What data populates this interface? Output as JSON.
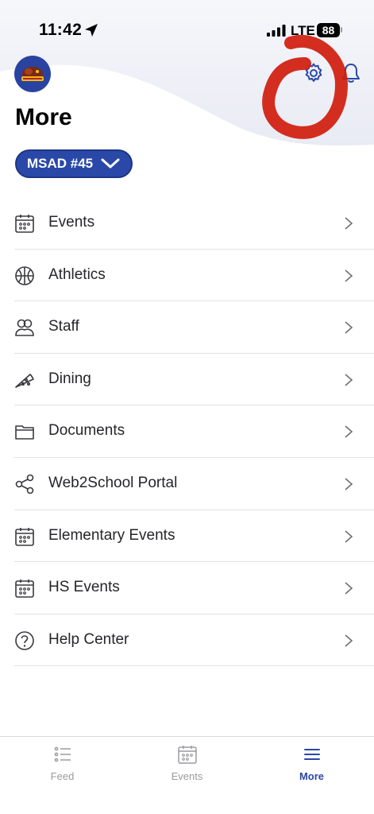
{
  "status_bar": {
    "time": "11:42",
    "network": "LTE",
    "battery": "88"
  },
  "header": {
    "logo_icon": "school-mascot-logo",
    "settings_icon": "gear-icon",
    "notifications_icon": "bell-icon",
    "title": "More"
  },
  "district_selector": {
    "label": "MSAD #45",
    "icon": "chevron-down-icon"
  },
  "menu": {
    "items": [
      {
        "label": "Events",
        "icon": "calendar-icon"
      },
      {
        "label": "Athletics",
        "icon": "basketball-icon"
      },
      {
        "label": "Staff",
        "icon": "people-icon"
      },
      {
        "label": "Dining",
        "icon": "pizza-icon"
      },
      {
        "label": "Documents",
        "icon": "folder-icon"
      },
      {
        "label": "Web2School Portal",
        "icon": "share-icon"
      },
      {
        "label": "Elementary Events",
        "icon": "calendar-icon"
      },
      {
        "label": "HS Events",
        "icon": "calendar-icon"
      },
      {
        "label": "Help Center",
        "icon": "question-circle-icon"
      }
    ]
  },
  "tab_bar": {
    "tabs": [
      {
        "label": "Feed",
        "icon": "list-icon",
        "active": false
      },
      {
        "label": "Events",
        "icon": "calendar-icon",
        "active": false
      },
      {
        "label": "More",
        "icon": "menu-icon",
        "active": true
      }
    ]
  },
  "colors": {
    "accent": "#2a48a8",
    "annotation": "#d01c0c",
    "header_wave": "#eceef6"
  }
}
